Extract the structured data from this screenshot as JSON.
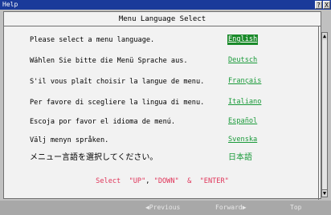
{
  "window": {
    "title": "Help",
    "help_btn": "?",
    "close_btn": "X"
  },
  "header": {
    "title": "Menu Language Select"
  },
  "rows": [
    {
      "prompt": "Please select a menu language.",
      "language": "English",
      "selected": true
    },
    {
      "prompt": "Wählen Sie bitte die Menü Sprache aus.",
      "language": "Deutsch",
      "selected": false
    },
    {
      "prompt": "S'il vous plaît choisir la langue de menu.",
      "language": "Français",
      "selected": false
    },
    {
      "prompt": "Per favore di scegliere la lingua di menu.",
      "language": "Italiano",
      "selected": false
    },
    {
      "prompt": "Escoja por favor el idioma de menú.",
      "language": "Español",
      "selected": false
    },
    {
      "prompt": "Välj menyn språken.",
      "language": "Svenska",
      "selected": false
    },
    {
      "prompt": "メニュー言語を選択してください。",
      "language": "日本語",
      "selected": false
    }
  ],
  "hint": {
    "select": "Select",
    "up": "\"UP\"",
    "comma": ",",
    "down": "\"DOWN\"",
    "amp": "&",
    "enter": "\"ENTER\""
  },
  "scrollbar": {
    "up_arrow": "▲",
    "down_arrow": "▼"
  },
  "footer": {
    "previous": "◀Previous",
    "forward": "Forward▶",
    "top": "Top"
  }
}
